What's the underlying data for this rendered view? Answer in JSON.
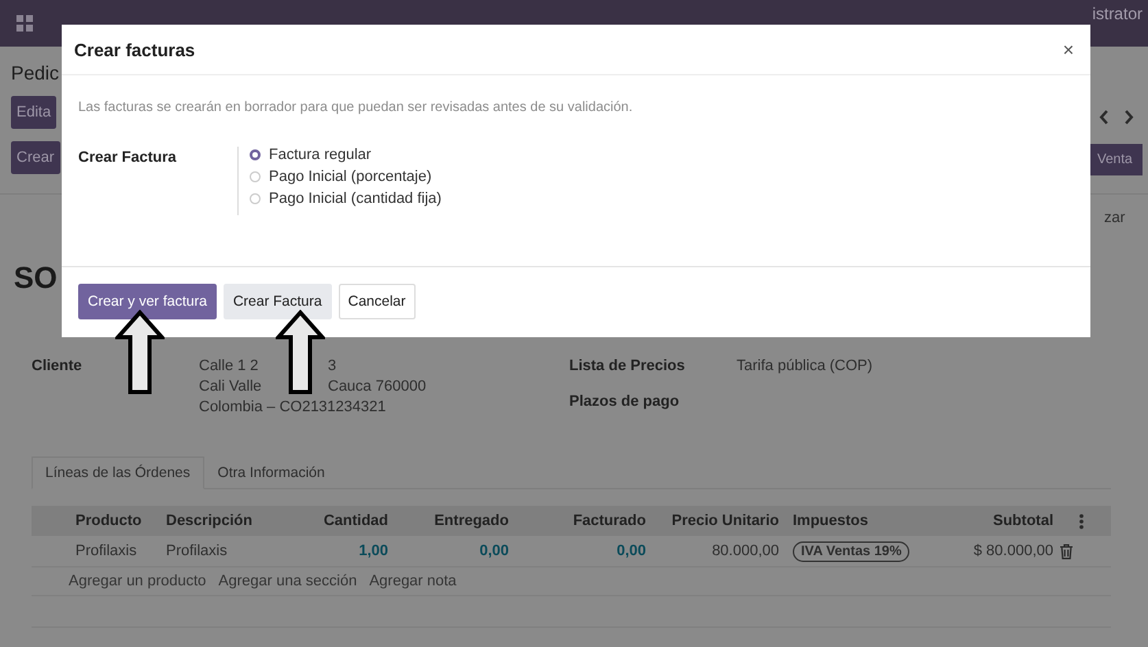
{
  "navbar": {
    "user": "istrator"
  },
  "control_panel": {
    "title": "Pedic",
    "buttons": [
      "Edita",
      "Crear"
    ],
    "action_button": "Venta",
    "status_text": "zar"
  },
  "record": {
    "name": "SO",
    "customer": {
      "label": "Cliente",
      "address_lines": [
        {
          "before": "Calle 1 2",
          "after": "3"
        },
        {
          "before": "Cali Valle",
          "after": "Cauca 760000"
        },
        {
          "before": "Colombia – CO2131234321"
        }
      ]
    },
    "fields": [
      {
        "label": "Lista de Precios",
        "value": "Tarifa pública (COP)"
      },
      {
        "label": "Plazos de pago"
      }
    ]
  },
  "tabs": [
    {
      "label": "Líneas de las Órdenes",
      "selected": true
    },
    {
      "label": "Otra Información",
      "selected": false
    }
  ],
  "table": {
    "columns": [
      {
        "label": "Producto"
      },
      {
        "label": "Descripción"
      },
      {
        "label": "Cantidad"
      },
      {
        "label": "Entregado"
      },
      {
        "label": "Facturado"
      },
      {
        "label": "Precio Unitario"
      },
      {
        "label": "Impuestos"
      },
      {
        "label": "Subtotal"
      }
    ],
    "rows": [
      {
        "cells": [
          {
            "kind": "text",
            "text": "Profilaxis"
          },
          {
            "kind": "text",
            "text": "Profilaxis"
          },
          {
            "kind": "number",
            "text": "1,00"
          },
          {
            "kind": "number",
            "text": "0,00"
          },
          {
            "kind": "number",
            "text": "0,00"
          },
          {
            "kind": "text",
            "text": "80.000,00"
          },
          {
            "kind": "tag",
            "text": "IVA Ventas 19%"
          },
          {
            "kind": "text",
            "text": "$ 80.000,00"
          }
        ]
      }
    ],
    "add_links": [
      "Agregar un producto",
      "Agregar una sección",
      "Agregar nota"
    ]
  },
  "dialog": {
    "title": "Crear facturas",
    "close": "×",
    "message": "Las facturas se crearán en borrador para que puedan ser revisadas antes de su validación.",
    "field_label": "Crear Factura",
    "options": [
      {
        "label": "Factura regular",
        "selected": true
      },
      {
        "label": "Pago Inicial (porcentaje)",
        "selected": false
      },
      {
        "label": "Pago Inicial (cantidad fija)",
        "selected": false
      }
    ],
    "buttons": [
      {
        "label": "Crear y ver factura",
        "kind": "primary"
      },
      {
        "label": "Crear Factura",
        "kind": "secondary"
      },
      {
        "label": "Cancelar",
        "kind": "default"
      }
    ]
  }
}
